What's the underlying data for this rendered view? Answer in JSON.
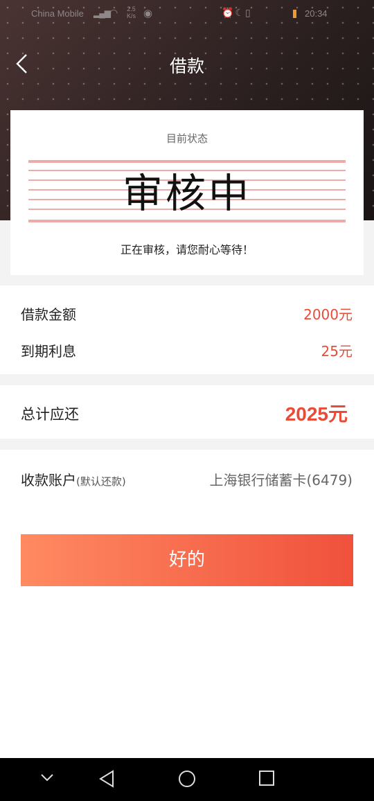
{
  "status_bar": {
    "carrier": "China Mobile",
    "net_speed_value": "2.5",
    "net_speed_unit": "K/s",
    "time": "20:34"
  },
  "navbar": {
    "title": "借款"
  },
  "status_card": {
    "caption": "目前状态",
    "status": "审核中",
    "note": "正在审核，请您耐心等待！"
  },
  "loan": {
    "amount_label": "借款金额",
    "amount_value": "2000元",
    "interest_label": "到期利息",
    "interest_value": "25元"
  },
  "total": {
    "label": "总计应还",
    "value": "2025元"
  },
  "account": {
    "label": "收款账户",
    "sub_label": "(默认还款)",
    "value": "上海银行储蓄卡(6479)"
  },
  "ok_button": {
    "label": "好的"
  },
  "colors": {
    "accent": "#e84b37",
    "button_start": "#ff8a62",
    "button_end": "#f0513c",
    "stamp_lines": "#ecaaa8"
  }
}
